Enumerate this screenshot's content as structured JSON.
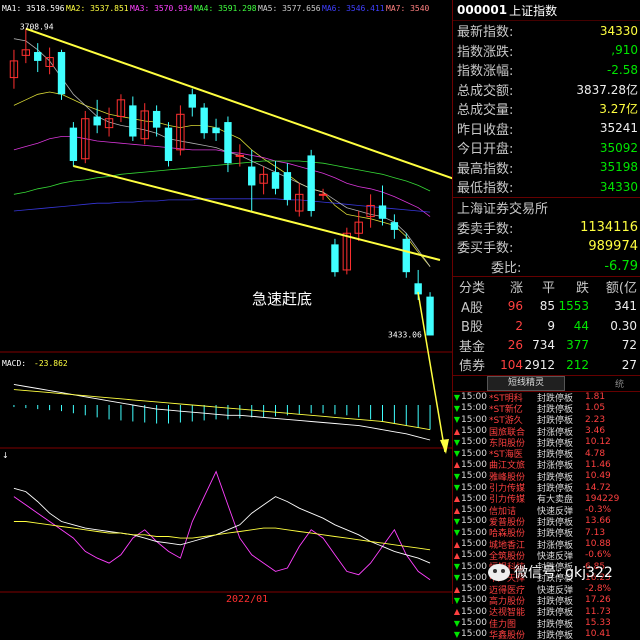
{
  "chart_data": {
    "type": "candlestick",
    "ma_legend": [
      {
        "name": "MA1:",
        "value": "3518.596",
        "color": "#ffffff"
      },
      {
        "name": "MA2:",
        "value": "3537.851",
        "color": "#ffff40"
      },
      {
        "name": "MA3:",
        "value": "3570.934",
        "color": "#ff40ff"
      },
      {
        "name": "MA4:",
        "value": "3591.298",
        "color": "#40ff40"
      },
      {
        "name": "MA5:",
        "value": "3577.656",
        "color": "#cccccc"
      },
      {
        "name": "MA6:",
        "value": "3546.411",
        "color": "#4040ff"
      },
      {
        "name": "MA7:",
        "value": "3540",
        "color": "#ff8080"
      }
    ],
    "high_label": "3708.94",
    "low_label": "3433.06",
    "annotation": "急速赶底",
    "date_label": "2022/01",
    "macd_label": "MACD:",
    "macd_value": "-23.862",
    "ylim": [
      3420,
      3715
    ],
    "candles": [
      {
        "o": 3665,
        "c": 3680,
        "h": 3690,
        "l": 3655
      },
      {
        "o": 3685,
        "c": 3690,
        "h": 3708.94,
        "l": 3678
      },
      {
        "o": 3688,
        "c": 3680,
        "h": 3696,
        "l": 3670
      },
      {
        "o": 3675,
        "c": 3683,
        "h": 3692,
        "l": 3668
      },
      {
        "o": 3688,
        "c": 3650,
        "h": 3690,
        "l": 3645
      },
      {
        "o": 3620,
        "c": 3590,
        "h": 3625,
        "l": 3585
      },
      {
        "o": 3592,
        "c": 3628,
        "h": 3635,
        "l": 3588
      },
      {
        "o": 3630,
        "c": 3622,
        "h": 3645,
        "l": 3615
      },
      {
        "o": 3620,
        "c": 3628,
        "h": 3638,
        "l": 3612
      },
      {
        "o": 3630,
        "c": 3645,
        "h": 3650,
        "l": 3625
      },
      {
        "o": 3640,
        "c": 3612,
        "h": 3648,
        "l": 3608
      },
      {
        "o": 3610,
        "c": 3635,
        "h": 3642,
        "l": 3605
      },
      {
        "o": 3635,
        "c": 3620,
        "h": 3640,
        "l": 3612
      },
      {
        "o": 3620,
        "c": 3590,
        "h": 3625,
        "l": 3585
      },
      {
        "o": 3600,
        "c": 3632,
        "h": 3640,
        "l": 3595
      },
      {
        "o": 3650,
        "c": 3638,
        "h": 3655,
        "l": 3630
      },
      {
        "o": 3638,
        "c": 3615,
        "h": 3642,
        "l": 3610
      },
      {
        "o": 3620,
        "c": 3615,
        "h": 3628,
        "l": 3608
      },
      {
        "o": 3625,
        "c": 3588,
        "h": 3630,
        "l": 3580
      },
      {
        "o": 3595,
        "c": 3595,
        "h": 3605,
        "l": 3585
      },
      {
        "o": 3585,
        "c": 3568,
        "h": 3600,
        "l": 3545
      },
      {
        "o": 3570,
        "c": 3578,
        "h": 3585,
        "l": 3560
      },
      {
        "o": 3580,
        "c": 3565,
        "h": 3590,
        "l": 3560
      },
      {
        "o": 3580,
        "c": 3555,
        "h": 3588,
        "l": 3550
      },
      {
        "o": 3545,
        "c": 3560,
        "h": 3570,
        "l": 3540
      },
      {
        "o": 3595,
        "c": 3545,
        "h": 3600,
        "l": 3540
      },
      {
        "o": 3560,
        "c": 3560,
        "h": 3565,
        "l": 3555
      },
      {
        "o": 3515,
        "c": 3490,
        "h": 3520,
        "l": 3486
      },
      {
        "o": 3492,
        "c": 3525,
        "h": 3530,
        "l": 3488
      },
      {
        "o": 3525,
        "c": 3535,
        "h": 3545,
        "l": 3518
      },
      {
        "o": 3540,
        "c": 3550,
        "h": 3560,
        "l": 3530
      },
      {
        "o": 3550,
        "c": 3538,
        "h": 3568,
        "l": 3532
      },
      {
        "o": 3535,
        "c": 3528,
        "h": 3542,
        "l": 3520
      },
      {
        "o": 3520,
        "c": 3490,
        "h": 3525,
        "l": 3485
      },
      {
        "o": 3480,
        "c": 3470,
        "h": 3492,
        "l": 3465
      },
      {
        "o": 3468,
        "c": 3433.06,
        "h": 3472,
        "l": 3433.06
      }
    ],
    "ma_lines": [
      {
        "color": "#ffff40",
        "values": [
          3640,
          3645,
          3650,
          3652,
          3650,
          3645,
          3640,
          3636,
          3632,
          3630,
          3628,
          3626,
          3625,
          3622,
          3620,
          3622,
          3622,
          3620,
          3615,
          3610,
          3600,
          3592,
          3585,
          3578,
          3570,
          3565,
          3562,
          3550,
          3542,
          3540,
          3538,
          3535,
          3532,
          3522,
          3508,
          3495
        ]
      },
      {
        "color": "#ff40ff",
        "values": [
          3600,
          3603,
          3606,
          3610,
          3612,
          3612,
          3610,
          3608,
          3607,
          3606,
          3605,
          3604,
          3603,
          3602,
          3601,
          3600,
          3600,
          3600,
          3598,
          3597,
          3595,
          3593,
          3590,
          3588,
          3585,
          3582,
          3579,
          3575,
          3570,
          3567,
          3565,
          3562,
          3558,
          3553,
          3548,
          3540
        ]
      },
      {
        "color": "#40ff40",
        "values": [
          3560,
          3562,
          3565,
          3567,
          3570,
          3572,
          3573,
          3575,
          3576,
          3578,
          3579,
          3580,
          3581,
          3582,
          3583,
          3584,
          3585,
          3586,
          3587,
          3588,
          3589,
          3590,
          3590,
          3590,
          3590,
          3589,
          3588,
          3586,
          3584,
          3582,
          3580,
          3578,
          3575,
          3572,
          3568,
          3563
        ]
      },
      {
        "color": "#4040ff",
        "values": [
          3545,
          3546,
          3547,
          3548,
          3549,
          3550,
          3551,
          3552,
          3552,
          3553,
          3553,
          3554,
          3554,
          3555,
          3555,
          3555,
          3556,
          3556,
          3556,
          3556,
          3556,
          3556,
          3556,
          3555,
          3555,
          3554,
          3553,
          3552,
          3551,
          3550,
          3549,
          3548,
          3547,
          3546,
          3545,
          3544
        ]
      },
      {
        "color": "#cccccc",
        "values": [
          3700,
          3698,
          3690,
          3680,
          3665,
          3650,
          3640,
          3630,
          3625,
          3622,
          3620,
          3618,
          3615,
          3610,
          3608,
          3606,
          3604,
          3602,
          3598,
          3595,
          3590,
          3585,
          3580,
          3575,
          3570,
          3565,
          3562,
          3555,
          3548,
          3545,
          3542,
          3540,
          3535,
          3525,
          3510,
          3495
        ]
      }
    ],
    "macd_bars": [
      -2,
      -3,
      -4,
      -5,
      -6,
      -8,
      -10,
      -12,
      -14,
      -15,
      -16,
      -17,
      -18,
      -18,
      -17,
      -16,
      -15,
      -14,
      -14,
      -13,
      -12,
      -12,
      -11,
      -10,
      -9,
      -8,
      -8,
      -9,
      -10,
      -12,
      -14,
      -16,
      -18,
      -20,
      -22,
      -23.862
    ],
    "macd_diff": [
      20,
      18,
      16,
      14,
      12,
      10,
      8,
      6,
      4,
      2,
      0,
      -2,
      -4,
      -5,
      -6,
      -7,
      -8,
      -9,
      -10,
      -10,
      -11,
      -12,
      -13,
      -14,
      -15,
      -16,
      -17,
      -18,
      -19,
      -20,
      -22,
      -24,
      -26,
      -28,
      -31,
      -34
    ],
    "macd_dea": [
      15,
      14,
      13,
      12,
      11,
      10,
      9,
      8,
      7,
      6,
      5,
      4,
      3,
      2,
      1,
      0,
      -1,
      -2,
      -3,
      -4,
      -5,
      -6,
      -7,
      -8,
      -9,
      -10,
      -11,
      -12,
      -13,
      -14,
      -15,
      -16,
      -18,
      -20,
      -22,
      -24
    ],
    "osc_white": [
      60,
      58,
      52,
      45,
      40,
      38,
      36,
      35,
      34,
      33,
      32,
      30,
      28,
      27,
      26,
      28,
      30,
      32,
      35,
      38,
      45,
      50,
      55,
      52,
      48,
      45,
      42,
      38,
      35,
      32,
      28,
      25,
      22,
      20,
      18,
      15
    ],
    "osc_purple": [
      55,
      50,
      45,
      40,
      35,
      30,
      22,
      18,
      15,
      20,
      30,
      35,
      28,
      22,
      18,
      40,
      55,
      70,
      50,
      30,
      20,
      15,
      10,
      12,
      25,
      35,
      30,
      20,
      10,
      8,
      15,
      25,
      35,
      20,
      10,
      5
    ],
    "osc_yellow": [
      40,
      40,
      39,
      38,
      37,
      36,
      35,
      34,
      33,
      33,
      32,
      32,
      31,
      31,
      30,
      30,
      31,
      32,
      33,
      34,
      35,
      36,
      36,
      35,
      34,
      33,
      32,
      31,
      30,
      29,
      28,
      27,
      26,
      25,
      24,
      23
    ]
  },
  "index": {
    "code": "000001",
    "name": "上证指数"
  },
  "quotes": [
    {
      "label": "最新指数:",
      "value": "34330",
      "color": "yellow"
    },
    {
      "label": "指数涨跌:",
      "value": ",910",
      "color": "green"
    },
    {
      "label": "指数涨幅:",
      "value": "-2.58",
      "color": "green"
    },
    {
      "label": "总成交额:",
      "value": "3837.28亿",
      "color": "white"
    },
    {
      "label": "总成交量:",
      "value": "3.27亿",
      "color": "yellow"
    },
    {
      "label": "昨日收盘:",
      "value": "35241",
      "color": "white"
    },
    {
      "label": "今日开盘:",
      "value": "35092",
      "color": "green"
    },
    {
      "label": "最高指数:",
      "value": "35198",
      "color": "green"
    },
    {
      "label": "最低指数:",
      "value": "34330",
      "color": "green"
    }
  ],
  "exchange": "上海证券交易所",
  "orders": [
    {
      "label": "委卖手数:",
      "value": "1134116",
      "color": "yellow"
    },
    {
      "label": "委买手数:",
      "value": "989974",
      "color": "yellow"
    },
    {
      "label": "委比:",
      "value": "-6.79",
      "color": "green"
    }
  ],
  "breadth_header": [
    "分类",
    "涨",
    "平",
    "跌",
    "额(亿"
  ],
  "breadth": [
    {
      "cat": "A股",
      "up": "96",
      "flat": "85",
      "down": "1553",
      "amt": "341"
    },
    {
      "cat": "B股",
      "up": "2",
      "flat": "9",
      "down": "44",
      "amt": "0.30"
    },
    {
      "cat": "基金",
      "up": "26",
      "flat": "734",
      "down": "377",
      "amt": "72"
    },
    {
      "cat": "债券",
      "up": "104",
      "flat": "2912",
      "down": "212",
      "amt": "27"
    }
  ],
  "tabs": {
    "short": "短线精灵",
    "other": "统"
  },
  "news": [
    {
      "dir": "down",
      "time": "15:00",
      "name": "*ST明科",
      "event": "封跌停板",
      "val": "1.81"
    },
    {
      "dir": "down",
      "time": "15:00",
      "name": "*ST新亿",
      "event": "封跌停板",
      "val": "1.05"
    },
    {
      "dir": "down",
      "time": "15:00",
      "name": "*ST游久",
      "event": "封跌停板",
      "val": "2.23"
    },
    {
      "dir": "up",
      "time": "15:00",
      "name": "国旅联合",
      "event": "封涨停板",
      "val": "3.46"
    },
    {
      "dir": "down",
      "time": "15:00",
      "name": "东阳股份",
      "event": "封跌停板",
      "val": "10.12"
    },
    {
      "dir": "down",
      "time": "15:00",
      "name": "*ST海医",
      "event": "封跌停板",
      "val": "4.78"
    },
    {
      "dir": "up",
      "time": "15:00",
      "name": "曲江文旅",
      "event": "封涨停板",
      "val": "11.46"
    },
    {
      "dir": "down",
      "time": "15:00",
      "name": "雅峰股份",
      "event": "封跌停板",
      "val": "10.49"
    },
    {
      "dir": "down",
      "time": "15:00",
      "name": "引力传媒",
      "event": "封跌停板",
      "val": "14.72"
    },
    {
      "dir": "up",
      "time": "15:00",
      "name": "引力传媒",
      "event": "有大卖盘",
      "val": "194229"
    },
    {
      "dir": "up",
      "time": "15:00",
      "name": "信加诘",
      "event": "快速反弹",
      "val": "-0.3%"
    },
    {
      "dir": "down",
      "time": "15:00",
      "name": "爱普股份",
      "event": "封跌停板",
      "val": "13.66"
    },
    {
      "dir": "down",
      "time": "15:00",
      "name": "哈森股份",
      "event": "封跌停板",
      "val": "7.13"
    },
    {
      "dir": "up",
      "time": "15:00",
      "name": "城地香江",
      "event": "封涨停板",
      "val": "10.88"
    },
    {
      "dir": "up",
      "time": "15:00",
      "name": "全筑股份",
      "event": "快速反弹",
      "val": "-0.6%"
    },
    {
      "dir": "down",
      "time": "15:00",
      "name": "恒银科技",
      "event": "封跌停板",
      "val": "6.85"
    },
    {
      "dir": "down",
      "time": "15:00",
      "name": "中广天择",
      "event": "封跌停板",
      "val": "16.23"
    },
    {
      "dir": "up",
      "time": "15:00",
      "name": "迈得医疗",
      "event": "快速反弹",
      "val": "-2.8%"
    },
    {
      "dir": "down",
      "time": "15:00",
      "name": "高力股份",
      "event": "封跌停板",
      "val": "17.26"
    },
    {
      "dir": "up",
      "time": "15:00",
      "name": "达视智能",
      "event": "封跌停板",
      "val": "11.73"
    },
    {
      "dir": "down",
      "time": "15:00",
      "name": "佳力图",
      "event": "封跌停板",
      "val": "15.33"
    },
    {
      "dir": "down",
      "time": "15:00",
      "name": "华鑫股份",
      "event": "封跌停板",
      "val": "10.41"
    }
  ],
  "watermark": "微信号: gkj322"
}
